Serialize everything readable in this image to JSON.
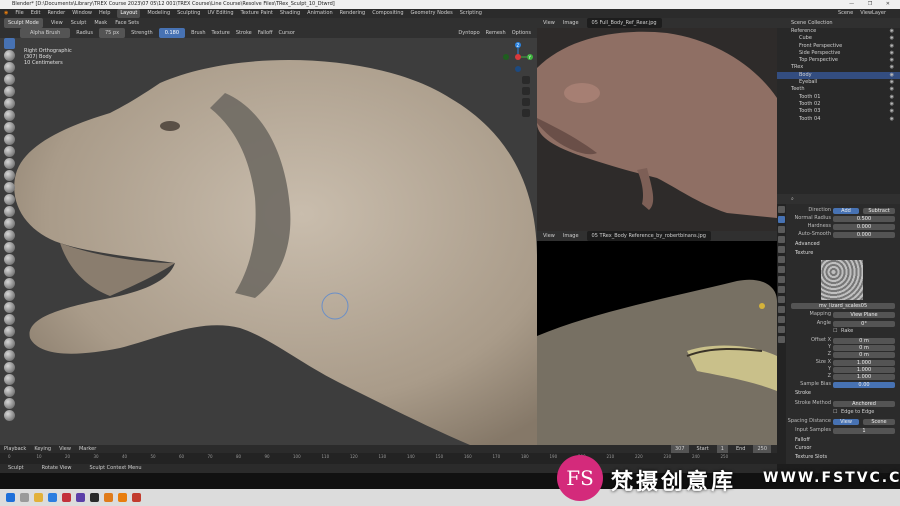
{
  "app": {
    "title": "Blender* [D:\\Documents\\Library\\TREX Course 2023\\07 05\\12 001\\TREX Course\\Line Course\\Resolve Files\\TRex_Sculpt_10_Dtwrd]",
    "window_controls": "— ❐ ✕"
  },
  "menubar": {
    "items": [
      "File",
      "Edit",
      "Render",
      "Window",
      "Help"
    ],
    "workspaces": [
      "Layout",
      "Modeling",
      "Sculpting",
      "UV Editing",
      "Texture Paint",
      "Shading",
      "Animation",
      "Rendering",
      "Compositing",
      "Geometry Nodes",
      "Scripting"
    ],
    "active_workspace": "Layout",
    "scene": "Scene",
    "view_layer": "ViewLayer"
  },
  "tool_header": {
    "mode": "Sculpt Mode",
    "menus": [
      "View",
      "Sculpt",
      "Mask",
      "Face Sets"
    ],
    "brush_name": "Alpha Brush",
    "radius_label": "Radius",
    "radius_value": "75 px",
    "strength_label": "Strength",
    "strength_value": "0.180",
    "dropdowns": [
      "Brush",
      "Texture",
      "Stroke",
      "Falloff",
      "Cursor"
    ],
    "right": [
      "Dyntopo",
      "Remesh",
      "Options"
    ]
  },
  "viewport": {
    "info_lines": [
      "Right Orthographic",
      "(307) Body",
      "10 Centimeters"
    ],
    "gizmo_axes": [
      "X",
      "Y",
      "Z"
    ]
  },
  "image_editor_top": {
    "menus": [
      "View",
      "Image"
    ],
    "filename": "05 Full_Body_Ref_Rear.jpg"
  },
  "image_editor_bottom": {
    "menus": [
      "View",
      "Image"
    ],
    "filename": "05 TRex_Body Reference_by_robertbinans.jpg"
  },
  "outliner": {
    "header": "Scene Collection",
    "rows": [
      {
        "label": "Reference",
        "selected": false
      },
      {
        "label": "Cube",
        "selected": false
      },
      {
        "label": "Front Perspective",
        "selected": false
      },
      {
        "label": "Side Perspective",
        "selected": false
      },
      {
        "label": "Top Perspective",
        "selected": false
      },
      {
        "label": "TRex",
        "selected": false
      },
      {
        "label": "Body",
        "selected": true
      },
      {
        "label": "Eyeball",
        "selected": false
      },
      {
        "label": "Teeth",
        "selected": false
      },
      {
        "label": "Tooth 01",
        "selected": false
      },
      {
        "label": "Tooth 02",
        "selected": false
      },
      {
        "label": "Tooth 03",
        "selected": false
      },
      {
        "label": "Tooth 04",
        "selected": false
      }
    ]
  },
  "properties": {
    "direction_label": "Direction",
    "direction_add": "Add",
    "direction_subtract": "Subtract",
    "normal_radius_label": "Normal Radius",
    "normal_radius_value": "0.500",
    "hardness_label": "Hardness",
    "hardness_value": "0.000",
    "auto_smooth_label": "Auto-Smooth",
    "auto_smooth_value": "0.000",
    "advanced_label": "Advanced",
    "texture_section": "Texture",
    "texture_name": "mv_lizard_scales05",
    "mapping_label": "Mapping",
    "mapping_value": "View Plane",
    "angle_label": "Angle",
    "angle_value": "0°",
    "rake_label": "Rake",
    "offset_x_label": "Offset X",
    "offset_x": "0 m",
    "offset_y_label": "Y",
    "offset_y": "0 m",
    "offset_z_label": "Z",
    "offset_z": "0 m",
    "size_x_label": "Size X",
    "size_x": "1.000",
    "size_y_label": "Y",
    "size_y": "1.000",
    "size_z_label": "Z",
    "size_z": "1.000",
    "sample_bias_label": "Sample Bias",
    "sample_bias": "0.00",
    "stroke_section": "Stroke",
    "stroke_method_label": "Stroke Method",
    "stroke_method": "Anchored",
    "edge_to_edge_label": "Edge to Edge",
    "spacing_label": "Spacing Distance",
    "spacing_view": "View",
    "spacing_scene": "Scene",
    "input_samples_label": "Input Samples",
    "input_samples": "1",
    "falloff_section": "Falloff",
    "cursor_section": "Cursor",
    "texture_slots_section": "Texture Slots"
  },
  "timeline": {
    "menus": [
      "Playback",
      "Keying",
      "View",
      "Marker"
    ],
    "frames": [
      "0",
      "10",
      "20",
      "30",
      "40",
      "50",
      "60",
      "70",
      "80",
      "90",
      "100",
      "110",
      "120",
      "130",
      "140",
      "150",
      "160",
      "170",
      "180",
      "190",
      "200",
      "210",
      "220",
      "230",
      "240",
      "250"
    ],
    "current_frame": "307",
    "start_label": "Start",
    "start": "1",
    "end_label": "End",
    "end": "250"
  },
  "statusbar": {
    "items": [
      "Sculpt",
      "Rotate View",
      "Sculpt Context Menu"
    ]
  },
  "watermark": {
    "logo_text": "FS",
    "brand": "梵摄创意库",
    "url": "WWW.FSTVC.CC"
  },
  "colors": {
    "accent": "#4772b3",
    "selection": "#334d80",
    "viewport_bg": "#3d3d3d",
    "model_skin": "#b8ab9a",
    "watermark_pink": "#d42a7b"
  }
}
